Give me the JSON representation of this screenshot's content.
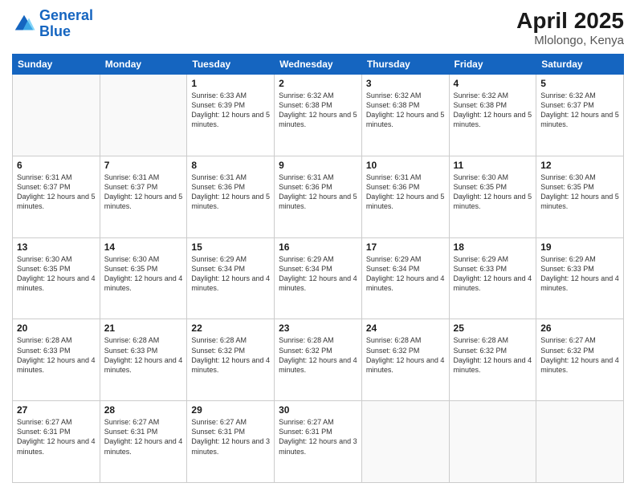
{
  "logo": {
    "text_general": "General",
    "text_blue": "Blue"
  },
  "header": {
    "month": "April 2025",
    "location": "Mlolongo, Kenya"
  },
  "weekdays": [
    "Sunday",
    "Monday",
    "Tuesday",
    "Wednesday",
    "Thursday",
    "Friday",
    "Saturday"
  ],
  "weeks": [
    [
      {
        "day": "",
        "info": ""
      },
      {
        "day": "",
        "info": ""
      },
      {
        "day": "1",
        "info": "Sunrise: 6:33 AM\nSunset: 6:39 PM\nDaylight: 12 hours and 5 minutes."
      },
      {
        "day": "2",
        "info": "Sunrise: 6:32 AM\nSunset: 6:38 PM\nDaylight: 12 hours and 5 minutes."
      },
      {
        "day": "3",
        "info": "Sunrise: 6:32 AM\nSunset: 6:38 PM\nDaylight: 12 hours and 5 minutes."
      },
      {
        "day": "4",
        "info": "Sunrise: 6:32 AM\nSunset: 6:38 PM\nDaylight: 12 hours and 5 minutes."
      },
      {
        "day": "5",
        "info": "Sunrise: 6:32 AM\nSunset: 6:37 PM\nDaylight: 12 hours and 5 minutes."
      }
    ],
    [
      {
        "day": "6",
        "info": "Sunrise: 6:31 AM\nSunset: 6:37 PM\nDaylight: 12 hours and 5 minutes."
      },
      {
        "day": "7",
        "info": "Sunrise: 6:31 AM\nSunset: 6:37 PM\nDaylight: 12 hours and 5 minutes."
      },
      {
        "day": "8",
        "info": "Sunrise: 6:31 AM\nSunset: 6:36 PM\nDaylight: 12 hours and 5 minutes."
      },
      {
        "day": "9",
        "info": "Sunrise: 6:31 AM\nSunset: 6:36 PM\nDaylight: 12 hours and 5 minutes."
      },
      {
        "day": "10",
        "info": "Sunrise: 6:31 AM\nSunset: 6:36 PM\nDaylight: 12 hours and 5 minutes."
      },
      {
        "day": "11",
        "info": "Sunrise: 6:30 AM\nSunset: 6:35 PM\nDaylight: 12 hours and 5 minutes."
      },
      {
        "day": "12",
        "info": "Sunrise: 6:30 AM\nSunset: 6:35 PM\nDaylight: 12 hours and 5 minutes."
      }
    ],
    [
      {
        "day": "13",
        "info": "Sunrise: 6:30 AM\nSunset: 6:35 PM\nDaylight: 12 hours and 4 minutes."
      },
      {
        "day": "14",
        "info": "Sunrise: 6:30 AM\nSunset: 6:35 PM\nDaylight: 12 hours and 4 minutes."
      },
      {
        "day": "15",
        "info": "Sunrise: 6:29 AM\nSunset: 6:34 PM\nDaylight: 12 hours and 4 minutes."
      },
      {
        "day": "16",
        "info": "Sunrise: 6:29 AM\nSunset: 6:34 PM\nDaylight: 12 hours and 4 minutes."
      },
      {
        "day": "17",
        "info": "Sunrise: 6:29 AM\nSunset: 6:34 PM\nDaylight: 12 hours and 4 minutes."
      },
      {
        "day": "18",
        "info": "Sunrise: 6:29 AM\nSunset: 6:33 PM\nDaylight: 12 hours and 4 minutes."
      },
      {
        "day": "19",
        "info": "Sunrise: 6:29 AM\nSunset: 6:33 PM\nDaylight: 12 hours and 4 minutes."
      }
    ],
    [
      {
        "day": "20",
        "info": "Sunrise: 6:28 AM\nSunset: 6:33 PM\nDaylight: 12 hours and 4 minutes."
      },
      {
        "day": "21",
        "info": "Sunrise: 6:28 AM\nSunset: 6:33 PM\nDaylight: 12 hours and 4 minutes."
      },
      {
        "day": "22",
        "info": "Sunrise: 6:28 AM\nSunset: 6:32 PM\nDaylight: 12 hours and 4 minutes."
      },
      {
        "day": "23",
        "info": "Sunrise: 6:28 AM\nSunset: 6:32 PM\nDaylight: 12 hours and 4 minutes."
      },
      {
        "day": "24",
        "info": "Sunrise: 6:28 AM\nSunset: 6:32 PM\nDaylight: 12 hours and 4 minutes."
      },
      {
        "day": "25",
        "info": "Sunrise: 6:28 AM\nSunset: 6:32 PM\nDaylight: 12 hours and 4 minutes."
      },
      {
        "day": "26",
        "info": "Sunrise: 6:27 AM\nSunset: 6:32 PM\nDaylight: 12 hours and 4 minutes."
      }
    ],
    [
      {
        "day": "27",
        "info": "Sunrise: 6:27 AM\nSunset: 6:31 PM\nDaylight: 12 hours and 4 minutes."
      },
      {
        "day": "28",
        "info": "Sunrise: 6:27 AM\nSunset: 6:31 PM\nDaylight: 12 hours and 4 minutes."
      },
      {
        "day": "29",
        "info": "Sunrise: 6:27 AM\nSunset: 6:31 PM\nDaylight: 12 hours and 3 minutes."
      },
      {
        "day": "30",
        "info": "Sunrise: 6:27 AM\nSunset: 6:31 PM\nDaylight: 12 hours and 3 minutes."
      },
      {
        "day": "",
        "info": ""
      },
      {
        "day": "",
        "info": ""
      },
      {
        "day": "",
        "info": ""
      }
    ]
  ]
}
